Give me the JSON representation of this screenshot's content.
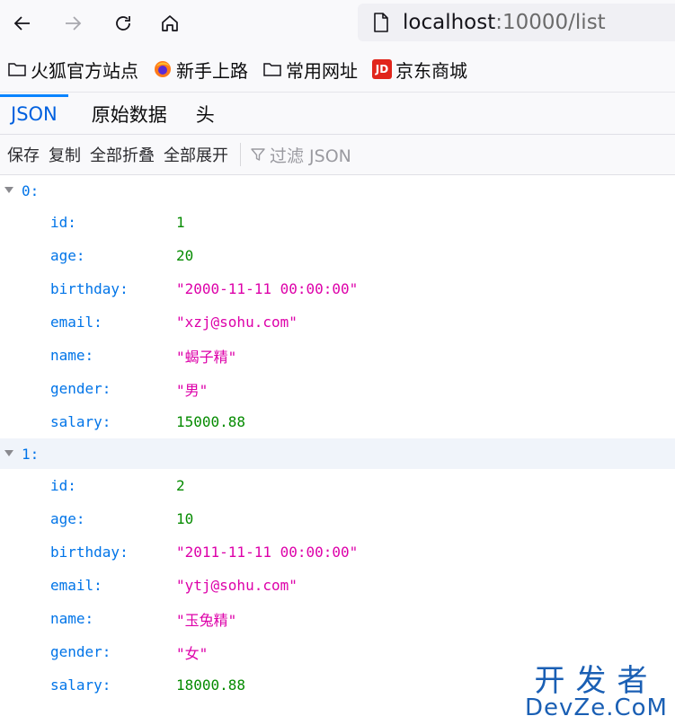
{
  "browser": {
    "url_host": "localhost",
    "url_rest": ":10000/list"
  },
  "bookmarks": [
    {
      "label": "火狐官方站点",
      "icon": "folder-icon"
    },
    {
      "label": "新手上路",
      "icon": "firefox-icon"
    },
    {
      "label": "常用网址",
      "icon": "folder-icon"
    },
    {
      "label": "京东商城",
      "icon": "jd-icon",
      "icon_text": "JD"
    }
  ],
  "tabs": [
    {
      "label": "JSON",
      "selected": true
    },
    {
      "label": "原始数据"
    },
    {
      "label": "头"
    }
  ],
  "toolbar": {
    "save": "保存",
    "copy": "复制",
    "collapse_all": "全部折叠",
    "expand_all": "全部展开",
    "filter_placeholder": "过滤 JSON"
  },
  "records": [
    {
      "index": "0:",
      "fields": [
        {
          "key": "id:",
          "value": "1",
          "type": "number"
        },
        {
          "key": "age:",
          "value": "20",
          "type": "number"
        },
        {
          "key": "birthday:",
          "value": "\"2000-11-11 00:00:00\"",
          "type": "string"
        },
        {
          "key": "email:",
          "value": "\"xzj@sohu.com\"",
          "type": "string"
        },
        {
          "key": "name:",
          "value": "\"蝎子精\"",
          "type": "string"
        },
        {
          "key": "gender:",
          "value": "\"男\"",
          "type": "string"
        },
        {
          "key": "salary:",
          "value": "15000.88",
          "type": "number"
        }
      ]
    },
    {
      "index": "1:",
      "fields": [
        {
          "key": "id:",
          "value": "2",
          "type": "number"
        },
        {
          "key": "age:",
          "value": "10",
          "type": "number"
        },
        {
          "key": "birthday:",
          "value": "\"2011-11-11 00:00:00\"",
          "type": "string"
        },
        {
          "key": "email:",
          "value": "\"ytj@sohu.com\"",
          "type": "string"
        },
        {
          "key": "name:",
          "value": "\"玉兔精\"",
          "type": "string"
        },
        {
          "key": "gender:",
          "value": "\"女\"",
          "type": "string"
        },
        {
          "key": "salary:",
          "value": "18000.88",
          "type": "number"
        }
      ]
    }
  ],
  "watermark": {
    "cn": "开发者",
    "en": "DevZe.CoM"
  },
  "colors": {
    "key": "#0074e8",
    "number": "#058b00",
    "string": "#dd00a9",
    "accent": "#0a84ff"
  }
}
